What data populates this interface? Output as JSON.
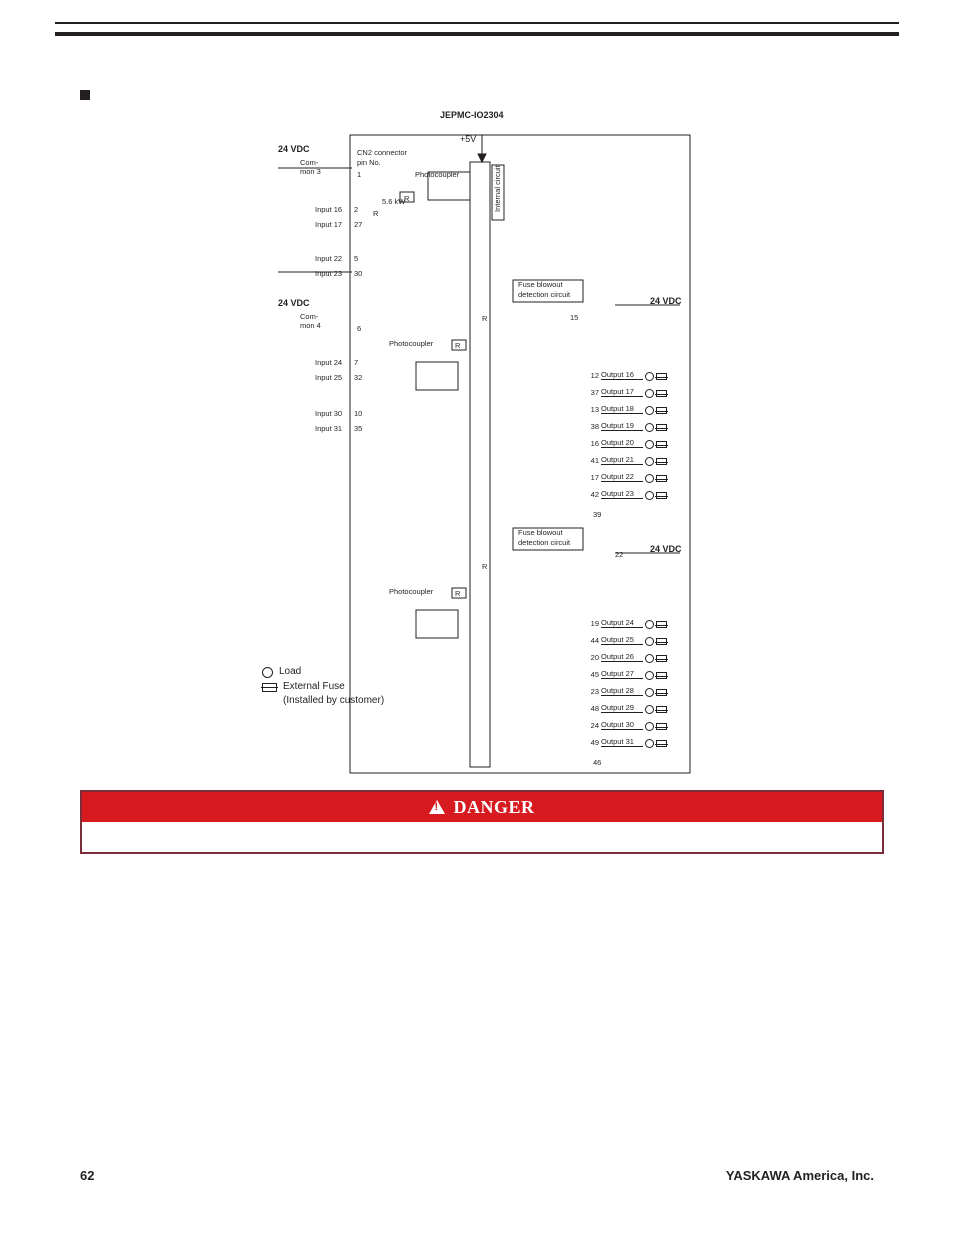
{
  "header": {},
  "legend": {
    "load": "Load",
    "fuse_line1": "External Fuse",
    "fuse_line2": "(Installed by customer)"
  },
  "danger": {
    "title": "DANGER"
  },
  "footer": {
    "page": "62",
    "company": "YASKAWA America, Inc."
  },
  "schem": {
    "title": "JEPMC-IO2304",
    "plus5v": "+5V",
    "vdc_24": "24 VDC",
    "common3_a": "Com-",
    "common3_b": "mon 3",
    "common4_a": "Com-",
    "common4_b": "mon 4",
    "cn2_a": "CN2 connector",
    "cn2_b": "pin No.",
    "pc": "Photocoupler",
    "r": "R",
    "kw": "5.6 kW",
    "internal": "Internal circuit",
    "fuse_a": "Fuse blowout",
    "fuse_b": "detection circuit",
    "inputs_top": [
      {
        "label": "Input 16",
        "pin": "2"
      },
      {
        "label": "Input 17",
        "pin": "27"
      },
      {
        "label": "Input 22",
        "pin": "5"
      },
      {
        "label": "Input 23",
        "pin": "30"
      }
    ],
    "inputs_bot": [
      {
        "label": "Input 24",
        "pin": "7"
      },
      {
        "label": "Input 25",
        "pin": "32"
      },
      {
        "label": "Input 30",
        "pin": "10"
      },
      {
        "label": "Input 31",
        "pin": "35"
      }
    ],
    "pin_common_top": "1",
    "pin_common_bot": "6",
    "out_right_pin_15": "15",
    "out_right_pin_22": "22",
    "out_block1_com_pin": "39",
    "out_block2_com_pin": "46",
    "outputs1": [
      {
        "pin": "12",
        "label": "Output 16"
      },
      {
        "pin": "37",
        "label": "Output 17"
      },
      {
        "pin": "13",
        "label": "Output 18"
      },
      {
        "pin": "38",
        "label": "Output 19"
      },
      {
        "pin": "16",
        "label": "Output 20"
      },
      {
        "pin": "41",
        "label": "Output 21"
      },
      {
        "pin": "17",
        "label": "Output 22"
      },
      {
        "pin": "42",
        "label": "Output 23"
      }
    ],
    "outputs2": [
      {
        "pin": "19",
        "label": "Output 24"
      },
      {
        "pin": "44",
        "label": "Output 25"
      },
      {
        "pin": "20",
        "label": "Output 26"
      },
      {
        "pin": "45",
        "label": "Output 27"
      },
      {
        "pin": "23",
        "label": "Output 28"
      },
      {
        "pin": "48",
        "label": "Output 29"
      },
      {
        "pin": "24",
        "label": "Output 30"
      },
      {
        "pin": "49",
        "label": "Output 31"
      }
    ]
  }
}
